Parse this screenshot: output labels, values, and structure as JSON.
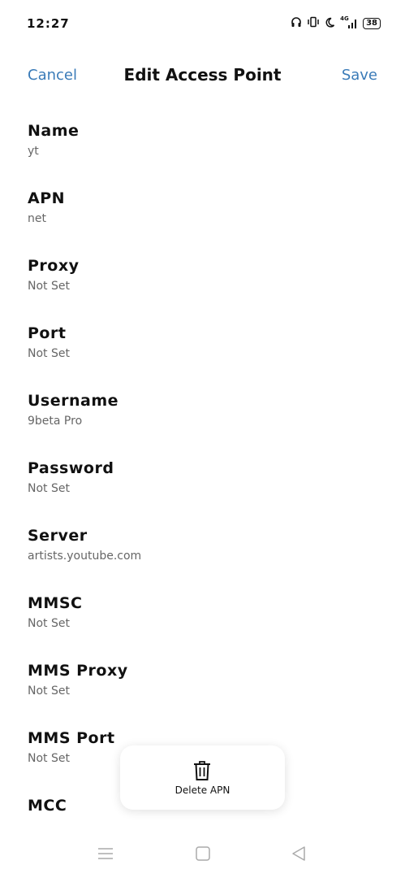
{
  "status": {
    "time": "12:27",
    "battery": "38",
    "network": "4G",
    "icons": [
      "headphones-icon",
      "vibrate-icon",
      "moon-icon",
      "signal-icon",
      "battery-icon"
    ]
  },
  "header": {
    "cancel": "Cancel",
    "title": "Edit Access Point",
    "save": "Save",
    "accent_color": "#3a7bb8"
  },
  "fields": [
    {
      "label": "Name",
      "value": "yt"
    },
    {
      "label": "APN",
      "value": "net"
    },
    {
      "label": "Proxy",
      "value": "Not Set"
    },
    {
      "label": "Port",
      "value": "Not Set"
    },
    {
      "label": "Username",
      "value": "9beta Pro"
    },
    {
      "label": "Password",
      "value": "Not Set"
    },
    {
      "label": "Server",
      "value": "artists.youtube.com"
    },
    {
      "label": "MMSC",
      "value": "Not Set"
    },
    {
      "label": "MMS Proxy",
      "value": "Not Set"
    },
    {
      "label": "MMS Port",
      "value": "Not Set"
    },
    {
      "label": "MCC",
      "value": ""
    }
  ],
  "delete_action": {
    "label": "Delete APN",
    "icon": "trash-icon"
  },
  "navbar": {
    "icons": [
      "menu-icon",
      "home-icon",
      "back-icon"
    ]
  }
}
